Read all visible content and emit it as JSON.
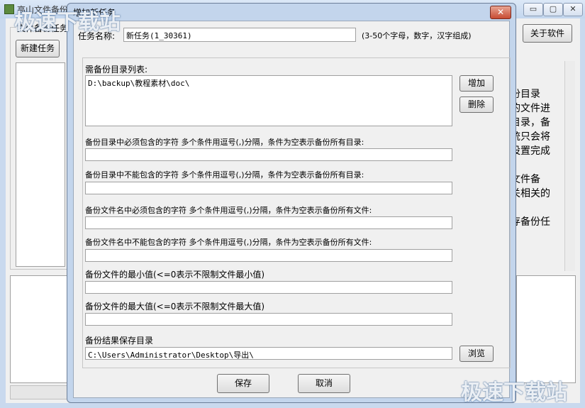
{
  "main_window": {
    "title": "高山文件备份",
    "group_label": "文件备份任务",
    "new_task_button": "新建任务",
    "about_button": "关于软件",
    "min_glyph": "▭",
    "max_glyph": "▢",
    "close_glyph": "✕",
    "help_lines": [
      "份目录",
      "的文件进",
      "目录，备",
      "统只会将",
      "设置完成",
      "",
      "文件备",
      "关相关的",
      "",
      "存备份任"
    ]
  },
  "dialog": {
    "title": "增加新任务",
    "close_glyph": "✕",
    "task_name_label": "任务名称:",
    "task_name_value": "新任务(1_30361)",
    "task_name_hint": "(3-50个字母，数字，汉字组成)",
    "dir_list_label": "需备份目录列表:",
    "dir_list_value": "D:\\backup\\教程素材\\doc\\",
    "add_button": "增加",
    "delete_button": "删除",
    "dir_include_label": "备份目录中必须包含的字符  多个条件用逗号(,)分隔，条件为空表示备份所有目录:",
    "dir_include_value": "",
    "dir_exclude_label": "备份目录中不能包含的字符  多个条件用逗号(,)分隔，条件为空表示备份所有目录:",
    "dir_exclude_value": "",
    "file_include_label": "备份文件名中必须包含的字符  多个条件用逗号(,)分隔，条件为空表示备份所有文件:",
    "file_include_value": "",
    "file_exclude_label": "备份文件名中不能包含的字符  多个条件用逗号(,)分隔，条件为空表示备份所有文件:",
    "file_exclude_value": "",
    "min_size_label": "备份文件的最小值(<=0表示不限制文件最小值)",
    "min_size_value": "",
    "max_size_label": "备份文件的最大值(<=0表示不限制文件最大值)",
    "max_size_value": "",
    "result_dir_label": "备份结果保存目录",
    "result_dir_value": "C:\\Users\\Administrator\\Desktop\\导出\\",
    "browse_button": "浏览",
    "save_button": "保存",
    "cancel_button": "取消"
  },
  "watermark": {
    "text": "极速下载站"
  },
  "colors": {
    "title_bar": "#c3d6ee",
    "close_button": "#c84b32",
    "window_bg": "#f0f0f0"
  }
}
